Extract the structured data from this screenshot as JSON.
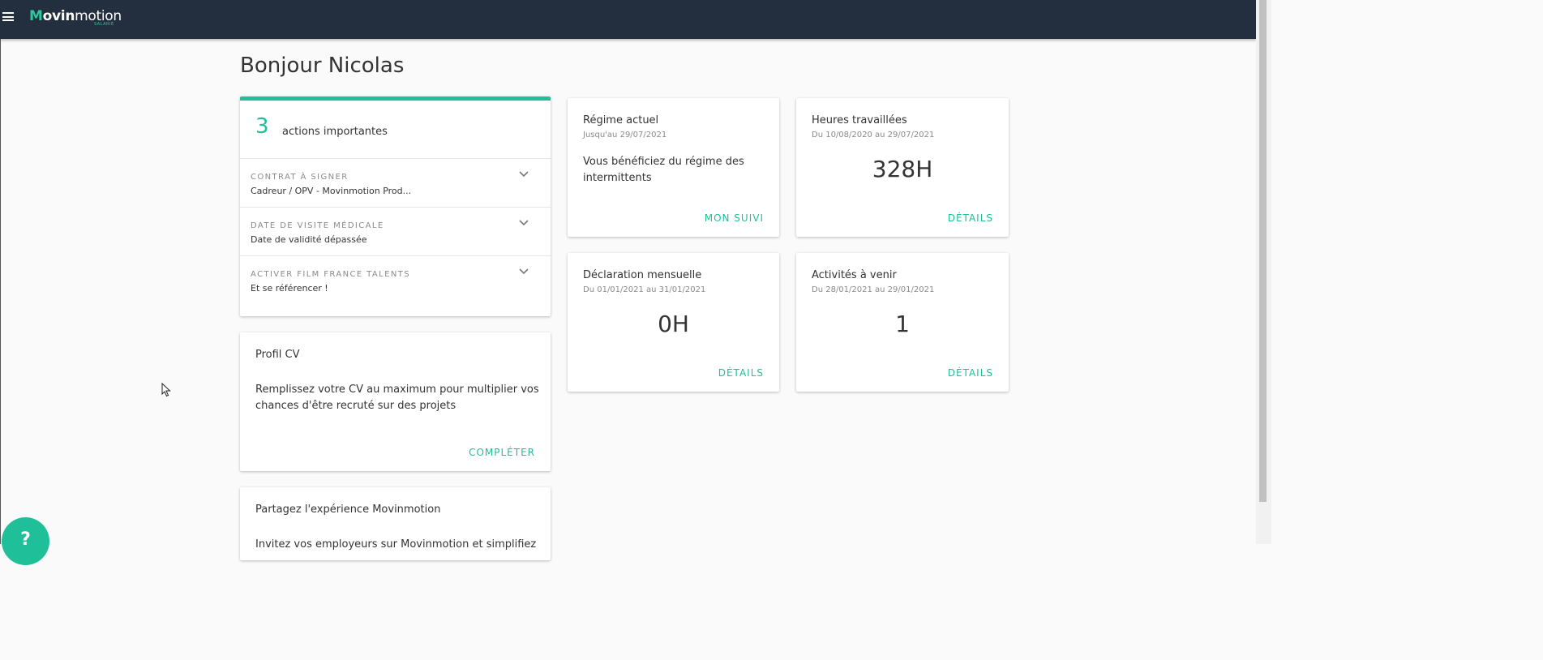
{
  "header": {
    "logo": {
      "m": "M",
      "ovin": "ovin",
      "motion": "motion",
      "sub": "SALARIÉ"
    },
    "menu_icon": "hamburger-icon"
  },
  "greeting": "Bonjour Nicolas",
  "actions": {
    "count": "3",
    "label": "actions importantes",
    "items": [
      {
        "title": "CONTRAT À SIGNER",
        "subtitle": "Cadreur / OPV - Movinmotion Prod..."
      },
      {
        "title": "DATE DE VISITE MÉDICALE",
        "subtitle": "Date de validité dépassée"
      },
      {
        "title": "ACTIVER FILM FRANCE TALENTS",
        "subtitle": "Et se référencer !"
      }
    ]
  },
  "regime": {
    "title": "Régime actuel",
    "subtitle": "Jusqu'au 29/07/2021",
    "text_line1": "Vous bénéficiez du régime des",
    "text_line2": "intermittents",
    "link": "MON SUIVI"
  },
  "heures": {
    "title": "Heures travaillées",
    "subtitle": "Du 10/08/2020 au 29/07/2021",
    "value": "328H",
    "link": "DÉTAILS"
  },
  "declaration": {
    "title": "Déclaration mensuelle",
    "subtitle": "Du 01/01/2021 au 31/01/2021",
    "value": "0H",
    "link": "DÉTAILS"
  },
  "activites": {
    "title": "Activités à venir",
    "subtitle": "Du 28/01/2021 au 29/01/2021",
    "value": "1",
    "link": "DÉTAILS"
  },
  "profil": {
    "title": "Profil CV",
    "text_line1": "Remplissez votre CV au maximum pour multiplier vos",
    "text_line2": "chances d'être recruté sur des projets",
    "link": "COMPLÉTER"
  },
  "partagez": {
    "title": "Partagez l'expérience Movinmotion",
    "text_partial": "Invitez vos employeurs sur Movinmotion et simplifiez"
  },
  "help": {
    "label": "?"
  },
  "colors": {
    "accent": "#1fbf99",
    "topbar": "#232f3e"
  }
}
